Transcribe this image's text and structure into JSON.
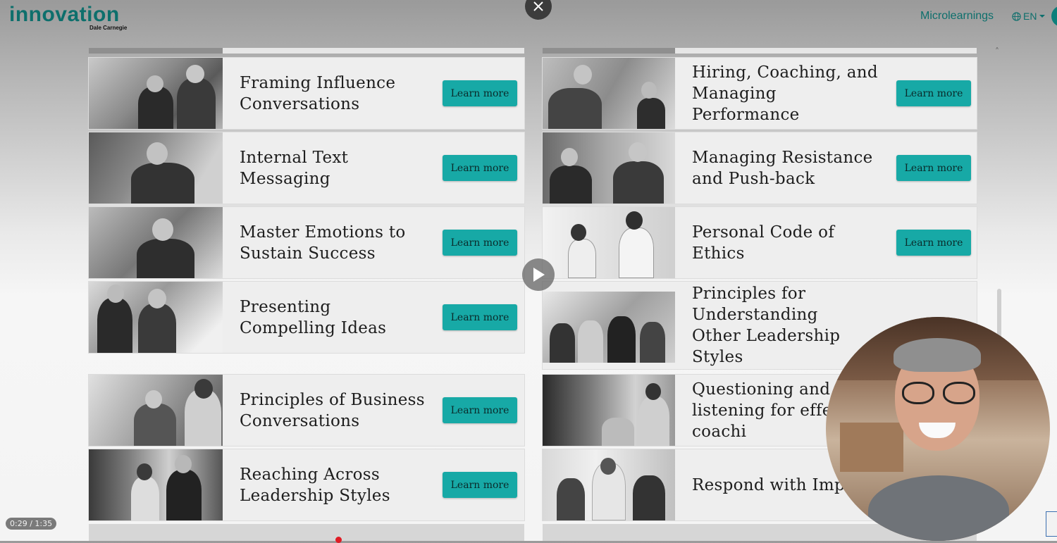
{
  "header": {
    "logo_text": "innovation",
    "logo_sub": "Dale Carnegie",
    "nav_link": "Microlearnings",
    "language": "EN"
  },
  "cards": [
    {
      "title": "Framing Influence Conversations",
      "button": "Learn more"
    },
    {
      "title": "Hiring, Coaching, and Managing Performance",
      "button": "Learn more"
    },
    {
      "title": "Internal Text Messaging",
      "button": "Learn more"
    },
    {
      "title": "Managing Resistance and Push-back",
      "button": "Learn more"
    },
    {
      "title": "Master Emotions to Sustain Success",
      "button": "Learn more"
    },
    {
      "title": "Personal Code of Ethics",
      "button": "Learn more"
    },
    {
      "title": "Presenting Compelling Ideas",
      "button": "Learn more"
    },
    {
      "title": "Principles for Understanding Other Leadership Styles",
      "button": ""
    },
    {
      "title": "Principles of Business Conversations",
      "button": "Learn more"
    },
    {
      "title": "Questioning and listening for effective coachi",
      "button": ""
    },
    {
      "title": "Reaching Across Leadership Styles",
      "button": "Learn more"
    },
    {
      "title": "Respond with Impact",
      "button": ""
    }
  ],
  "player": {
    "timecode": "0:29 / 1:35"
  },
  "colors": {
    "brand": "#0d6f6c",
    "button": "#17a9a6"
  }
}
